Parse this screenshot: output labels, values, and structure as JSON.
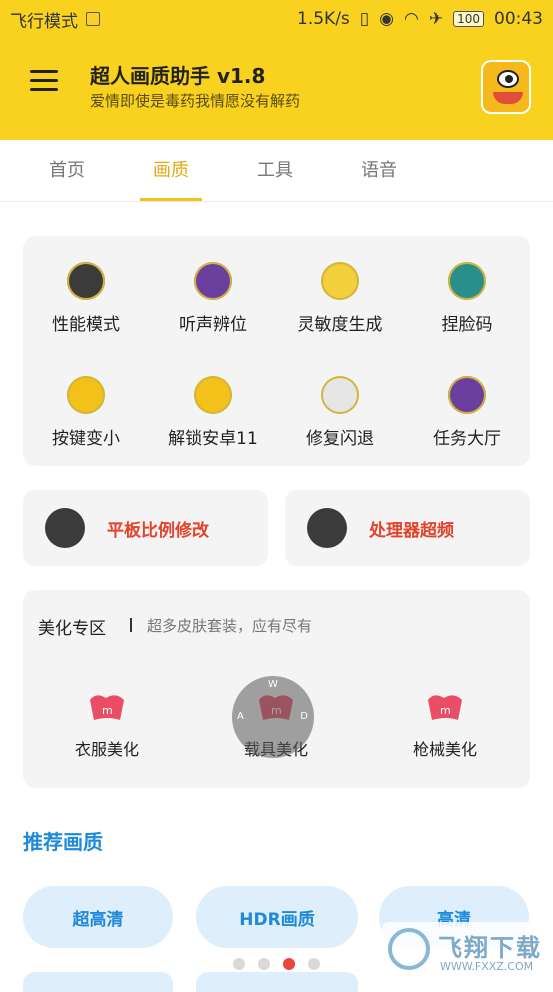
{
  "status_bar": {
    "mode": "飞行模式",
    "speed": "1.5K/s",
    "battery": "100",
    "time": "00:43"
  },
  "app": {
    "title": "超人画质助手 v1.8",
    "subtitle": "爱情即使是毒药我情愿没有解药"
  },
  "tabs": [
    {
      "label": "首页"
    },
    {
      "label": "画质",
      "active": true
    },
    {
      "label": "工具"
    },
    {
      "label": "语音"
    }
  ],
  "grid": [
    {
      "label": "性能模式",
      "icon": "cherry-icon",
      "color": "#3b3b3b"
    },
    {
      "label": "听声辨位",
      "icon": "gameboy-icon",
      "color": "#6a3fa0"
    },
    {
      "label": "灵敏度生成",
      "icon": "camera-icon",
      "color": "#f2d03b"
    },
    {
      "label": "捏脸码",
      "icon": "test-tube-icon",
      "color": "#2a8f8a"
    },
    {
      "label": "按键变小",
      "icon": "spider-icon",
      "color": "#f2c21b"
    },
    {
      "label": "解锁安卓11",
      "icon": "phone-icon",
      "color": "#f2c21b"
    },
    {
      "label": "修复闪退",
      "icon": "sushi-icon",
      "color": "#e6e6e6"
    },
    {
      "label": "任务大厅",
      "icon": "cinema-icon",
      "color": "#6a3fa0"
    }
  ],
  "features": [
    {
      "label": "平板比例修改",
      "icon": "plant-icon",
      "color": "#3b3b3b"
    },
    {
      "label": "处理器超频",
      "icon": "rocket-icon",
      "color": "#3b3b3b"
    }
  ],
  "beauty": {
    "heading": "美化专区",
    "subheading": "超多皮肤套装，应有尽有",
    "items": [
      {
        "label": "衣服美化",
        "icon": "skin-logo-icon"
      },
      {
        "label": "载具美化",
        "icon": "skin-logo-icon"
      },
      {
        "label": "枪械美化",
        "icon": "skin-logo-icon"
      }
    ]
  },
  "joystick": {
    "up": "W",
    "left": "A",
    "right": "D"
  },
  "recommend": {
    "title": "推荐画质",
    "options": [
      "超高清",
      "HDR画质",
      "高清"
    ]
  },
  "pager": {
    "count": 4,
    "active": 2
  },
  "watermark": {
    "text": "飞翔下载",
    "url": "WWW.FXXZ.COM"
  },
  "colors": {
    "accent": "#f9d21f",
    "tab_active": "#e3a814",
    "blue": "#1e8ad8",
    "red": "#e3422b"
  }
}
